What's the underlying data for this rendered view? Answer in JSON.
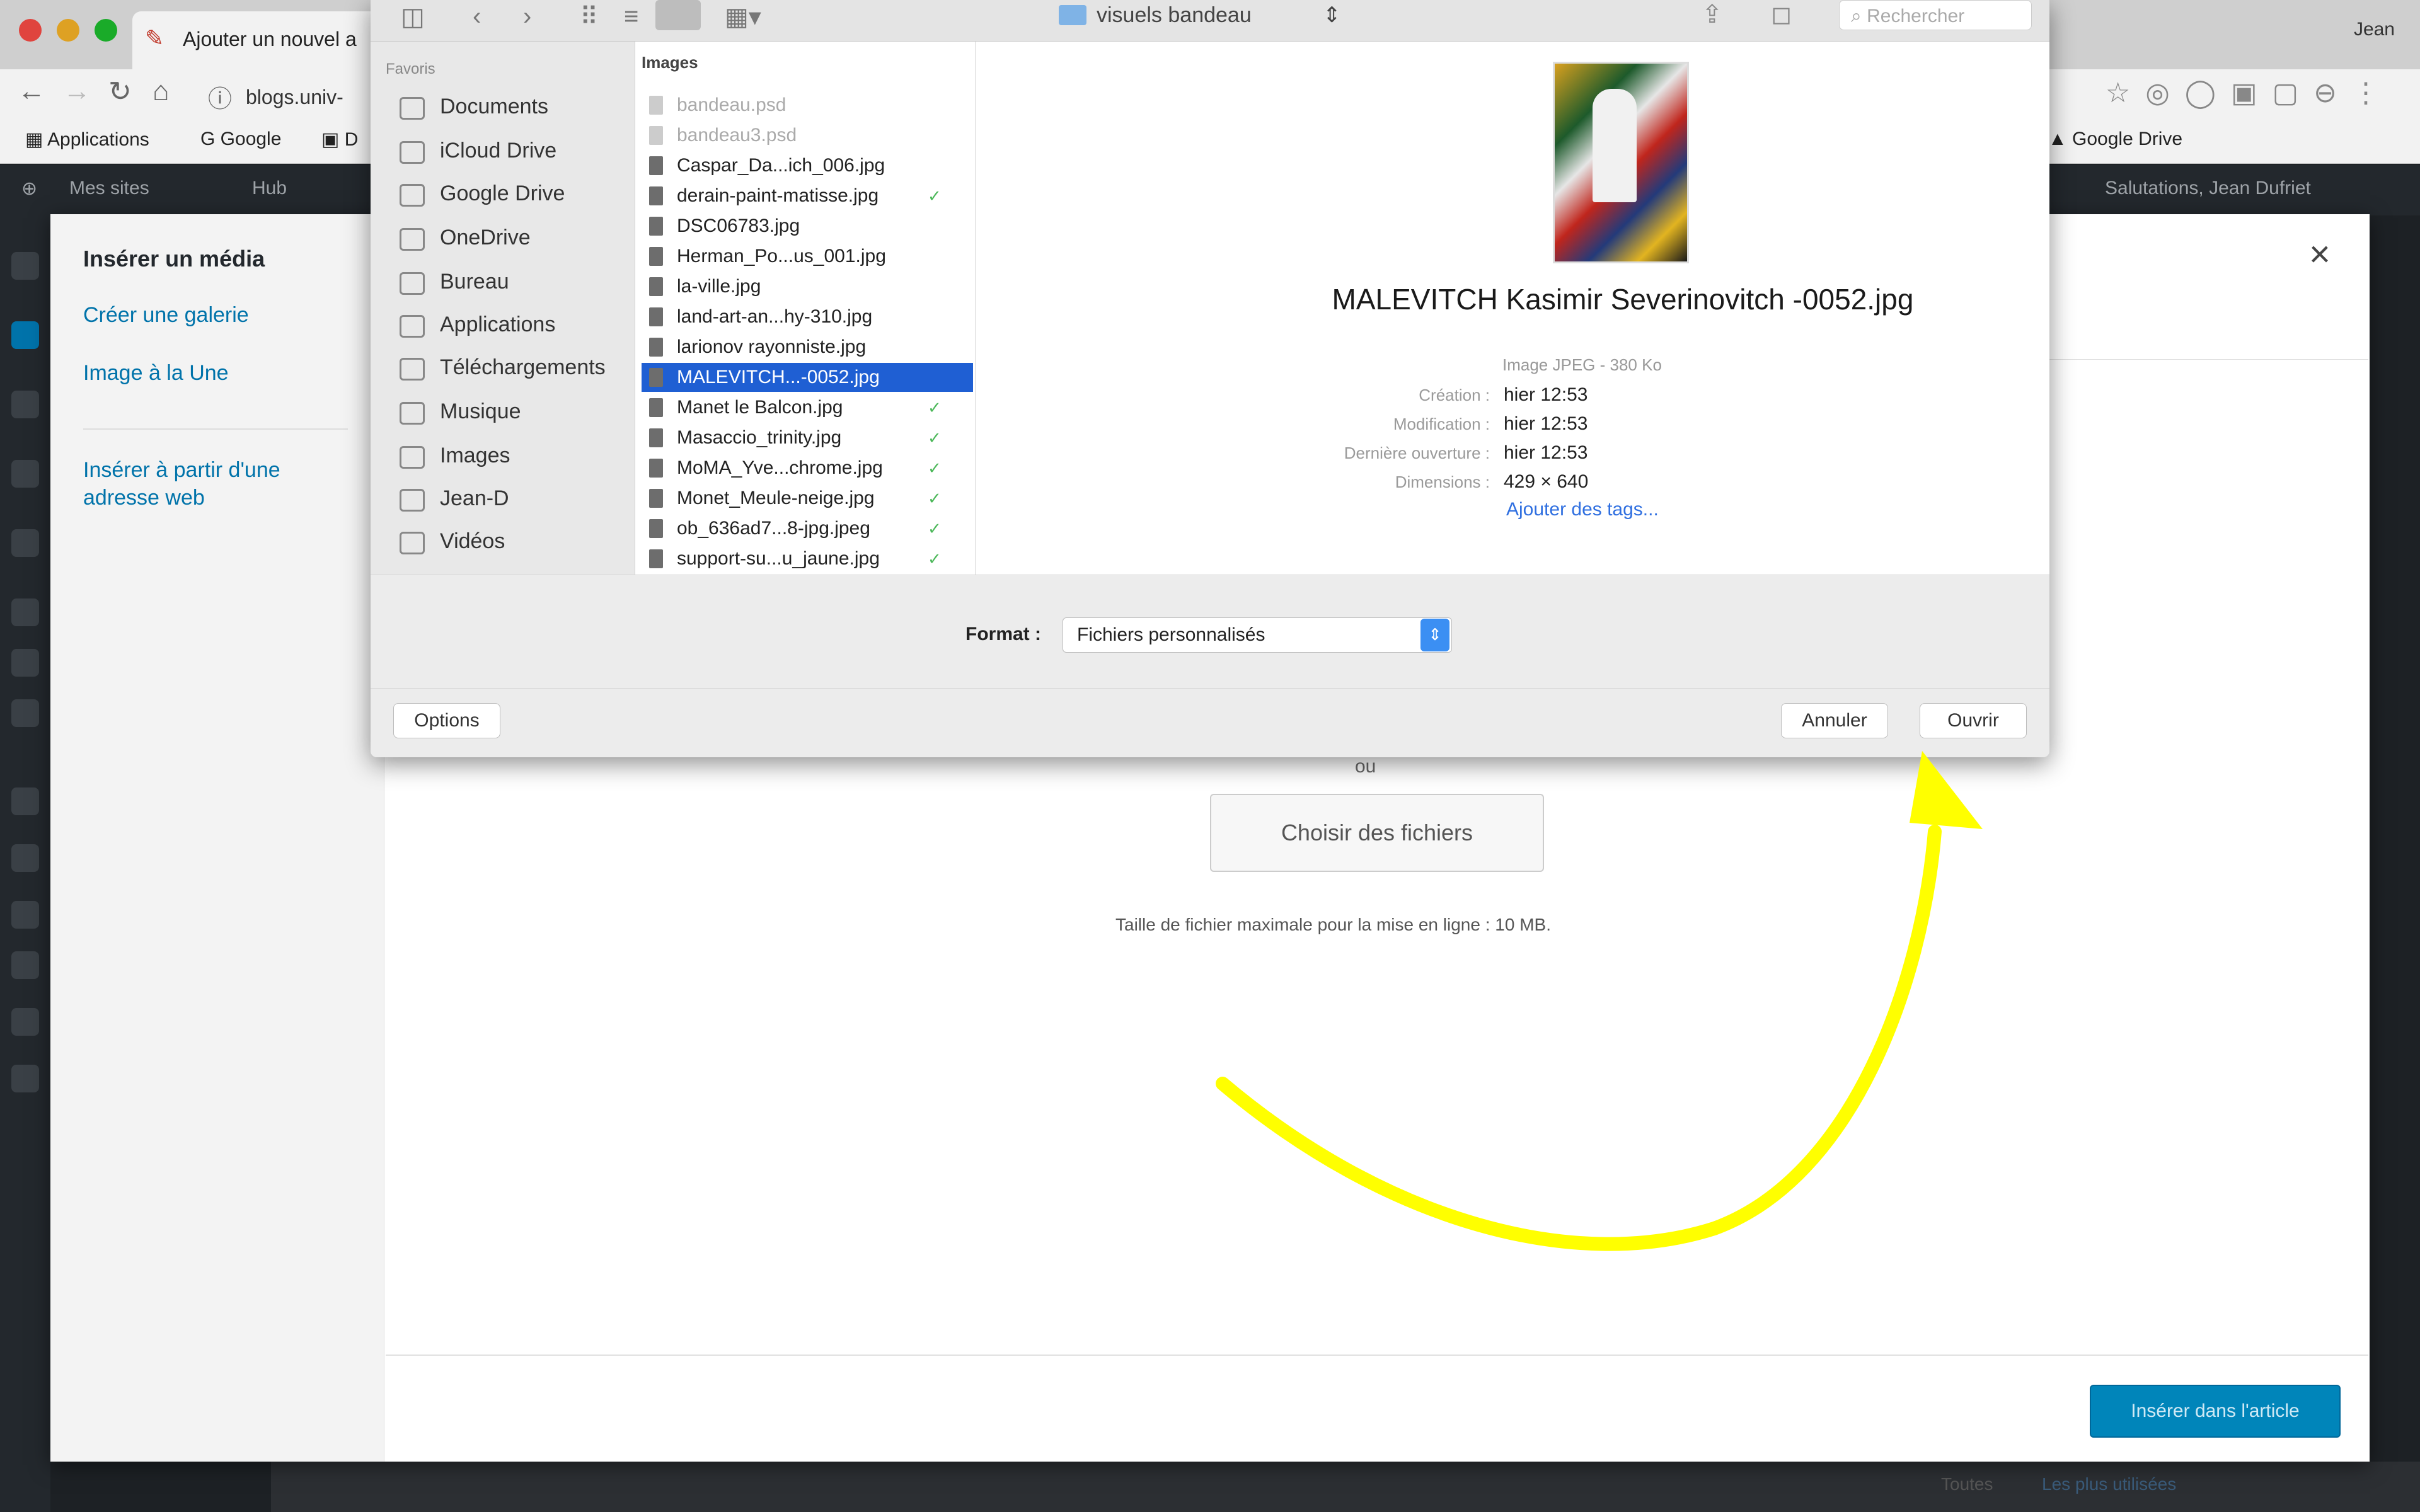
{
  "browser": {
    "tab_title": "Ajouter un nouvel a",
    "url": "blogs.univ-",
    "user": "Jean",
    "bookmarks": [
      "Applications",
      "Google",
      "D",
      "Google Drive"
    ]
  },
  "adminbar": {
    "items": [
      "Mes sites",
      "Hub"
    ],
    "right": "Salutations, Jean Dufriet"
  },
  "media_modal": {
    "title": "Insérer un média",
    "menu": [
      "Créer une galerie",
      "Image à la Une",
      "Insérer à partir d'une adresse web"
    ],
    "or_text": "ou",
    "choose_files": "Choisir des fichiers",
    "max_size": "Taille de fichier maximale pour la mise en ligne : 10 MB.",
    "insert_button": "Insérer dans l'article",
    "close": "×",
    "bottom_links": [
      "Toutes",
      "Les plus utilisées"
    ]
  },
  "file_dialog": {
    "folder": "visuels bandeau",
    "search_placeholder": "Rechercher",
    "favorites_title": "Favoris",
    "favorites": [
      "Documents",
      "iCloud Drive",
      "Google Drive",
      "OneDrive",
      "Bureau",
      "Applications",
      "Téléchargements",
      "Musique",
      "Images",
      "Jean-D",
      "Vidéos"
    ],
    "column_header": "Images",
    "files": [
      {
        "name": "bandeau.psd",
        "dim": true,
        "check": false
      },
      {
        "name": "bandeau3.psd",
        "dim": true,
        "check": false
      },
      {
        "name": "Caspar_Da...ich_006.jpg",
        "dim": false,
        "check": false
      },
      {
        "name": "derain-paint-matisse.jpg",
        "dim": false,
        "check": true
      },
      {
        "name": "DSC06783.jpg",
        "dim": false,
        "check": false
      },
      {
        "name": "Herman_Po...us_001.jpg",
        "dim": false,
        "check": false
      },
      {
        "name": "la-ville.jpg",
        "dim": false,
        "check": false
      },
      {
        "name": "land-art-an...hy-310.jpg",
        "dim": false,
        "check": false
      },
      {
        "name": "larionov rayonniste.jpg",
        "dim": false,
        "check": false
      },
      {
        "name": "MALEVITCH...-0052.jpg",
        "dim": false,
        "check": false,
        "selected": true
      },
      {
        "name": "Manet le Balcon.jpg",
        "dim": false,
        "check": true
      },
      {
        "name": "Masaccio_trinity.jpg",
        "dim": false,
        "check": true
      },
      {
        "name": "MoMA_Yve...chrome.jpg",
        "dim": false,
        "check": true
      },
      {
        "name": "Monet_Meule-neige.jpg",
        "dim": false,
        "check": true
      },
      {
        "name": "ob_636ad7...8-jpg.jpeg",
        "dim": false,
        "check": true
      },
      {
        "name": "support-su...u_jaune.jpg",
        "dim": false,
        "check": true
      }
    ],
    "preview": {
      "name": "MALEVITCH Kasimir Severinovitch  -0052.jpg",
      "kind": "Image JPEG - 380 Ko",
      "meta": [
        {
          "label": "Création :",
          "value": "hier 12:53"
        },
        {
          "label": "Modification :",
          "value": "hier 12:53"
        },
        {
          "label": "Dernière ouverture :",
          "value": "hier 12:53"
        },
        {
          "label": "Dimensions :",
          "value": "429 × 640"
        }
      ],
      "add_tags": "Ajouter des tags..."
    },
    "format_label": "Format :",
    "format_value": "Fichiers personnalisés",
    "options_button": "Options",
    "cancel_button": "Annuler",
    "open_button": "Ouvrir"
  },
  "colors": {
    "annotation_arrow": "#ffff00",
    "selection": "#1f5fd3",
    "wp_primary": "#0085ba"
  }
}
